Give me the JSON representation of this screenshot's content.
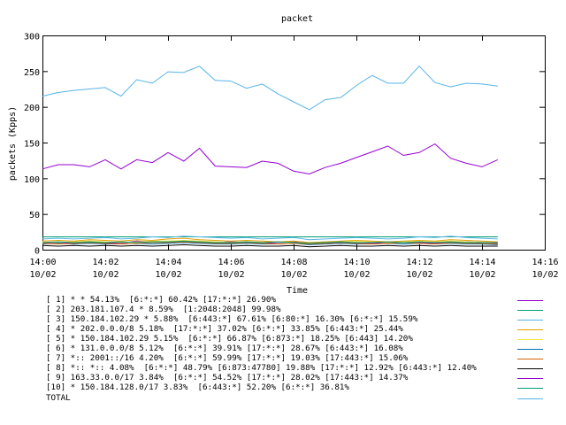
{
  "chart_data": {
    "type": "line",
    "title": "packet",
    "xlabel": "Time",
    "ylabel": "packets (Kpps)",
    "ylim": [
      0,
      300
    ],
    "yticks": [
      "0",
      "50",
      "100",
      "150",
      "200",
      "250",
      "300"
    ],
    "xticks": [
      {
        "time": "14:00",
        "date": "10/02"
      },
      {
        "time": "14:02",
        "date": "10/02"
      },
      {
        "time": "14:04",
        "date": "10/02"
      },
      {
        "time": "14:06",
        "date": "10/02"
      },
      {
        "time": "14:08",
        "date": "10/02"
      },
      {
        "time": "14:10",
        "date": "10/02"
      },
      {
        "time": "14:12",
        "date": "10/02"
      },
      {
        "time": "14:14",
        "date": "10/02"
      },
      {
        "time": "14:16",
        "date": "10/02"
      }
    ],
    "x": [
      "14:00",
      "14:00:30",
      "14:01",
      "14:01:30",
      "14:02",
      "14:02:30",
      "14:03",
      "14:03:30",
      "14:04",
      "14:04:30",
      "14:05",
      "14:05:30",
      "14:06",
      "14:06:30",
      "14:07",
      "14:07:30",
      "14:08",
      "14:08:30",
      "14:09",
      "14:09:30",
      "14:10",
      "14:10:30",
      "14:11",
      "14:11:30",
      "14:12",
      "14:12:30",
      "14:13",
      "14:13:30",
      "14:14",
      "14:14:30"
    ],
    "legend_position": "bottom",
    "grid": false,
    "series": [
      {
        "name": "[ 1] * * 54.13%  [6:*:*] 60.42% [17:*:*] 26.90%",
        "color": "#9400d3",
        "values": [
          10,
          10,
          9,
          11,
          10,
          9,
          12,
          11,
          10,
          12,
          11,
          10,
          11,
          10,
          9,
          10,
          11,
          9,
          8,
          9,
          10,
          9,
          10,
          11,
          10,
          9,
          10,
          11,
          10,
          9
        ]
      },
      {
        "name": "[ 2] 203.181.107.4 * 8.59%  [1:2048:2048] 99.98%",
        "color": "#009e73",
        "values": [
          18,
          18,
          18,
          18,
          18,
          18,
          18,
          18,
          18,
          18,
          18,
          18,
          18,
          18,
          18,
          18,
          18,
          18,
          18,
          18,
          18,
          18,
          18,
          18,
          18,
          18,
          18,
          18,
          18,
          18
        ]
      },
      {
        "name": "[ 3] 150.184.102.29 * 5.88%  [6:443:*] 67.61% [6:80:*] 16.30% [6:*:*] 15.59%",
        "color": "#56b4e9",
        "values": [
          15,
          16,
          15,
          16,
          17,
          15,
          16,
          18,
          17,
          19,
          18,
          17,
          16,
          17,
          15,
          16,
          17,
          14,
          15,
          16,
          17,
          16,
          15,
          16,
          18,
          17,
          19,
          17,
          16,
          15
        ]
      },
      {
        "name": "[ 4] * 202.0.0.0/8 5.18%  [17:*:*] 37.02% [6:*:*] 33.85% [6:443:*] 25.44%",
        "color": "#e69f00",
        "values": [
          12,
          13,
          12,
          14,
          13,
          12,
          14,
          13,
          15,
          16,
          14,
          13,
          12,
          13,
          12,
          11,
          12,
          10,
          11,
          12,
          13,
          12,
          11,
          12,
          13,
          12,
          14,
          13,
          12,
          11
        ]
      },
      {
        "name": "[ 5] * 150.184.102.29 5.15%  [6:*:*] 66.87% [6:873:*] 18.25% [6:443] 14.20%",
        "color": "#f0e442",
        "values": [
          11,
          10,
          11,
          12,
          11,
          10,
          11,
          12,
          12,
          13,
          12,
          11,
          10,
          11,
          10,
          11,
          10,
          9,
          10,
          11,
          12,
          11,
          10,
          11,
          12,
          11,
          12,
          11,
          10,
          10
        ]
      },
      {
        "name": "[ 6] * 131.0.0.0/8 5.12%  [6:*:*] 39.91% [17:*:*] 28.67% [6:443:*] 16.08%",
        "color": "#0072b2",
        "values": [
          8,
          9,
          8,
          9,
          8,
          8,
          9,
          8,
          9,
          10,
          9,
          8,
          8,
          9,
          8,
          8,
          9,
          7,
          8,
          9,
          8,
          8,
          9,
          8,
          9,
          8,
          9,
          8,
          8,
          7
        ]
      },
      {
        "name": "[ 7] *:: 2001::/16 4.20%  [6:*:*] 59.99% [17:*:*] 19.03% [17:443:*] 15.06%",
        "color": "#d55e00",
        "values": [
          9,
          8,
          9,
          10,
          9,
          8,
          9,
          10,
          10,
          11,
          10,
          9,
          9,
          10,
          9,
          8,
          9,
          8,
          9,
          10,
          9,
          8,
          9,
          10,
          9,
          8,
          10,
          9,
          9,
          8
        ]
      },
      {
        "name": "[ 8] *:: *:: 4.08%  [6:*:*] 48.79% [6:873:47780] 19.88% [17:*:*] 12.92% [6:443:*] 12.40%",
        "color": "#000000",
        "values": [
          6,
          5,
          6,
          5,
          6,
          5,
          6,
          5,
          6,
          7,
          6,
          5,
          5,
          6,
          5,
          5,
          6,
          4,
          5,
          6,
          5,
          5,
          6,
          5,
          6,
          5,
          6,
          5,
          5,
          5
        ]
      },
      {
        "name": "[ 9] 163.33.0.0/17 3.84%  [6:*:*] 54.52% [17:*:*] 28.02% [17:443:*] 14.37%",
        "color": "#9400d3",
        "values": [
          113,
          119,
          119,
          116,
          126,
          113,
          126,
          122,
          136,
          124,
          142,
          117,
          116,
          115,
          124,
          121,
          110,
          106,
          115,
          121,
          129,
          137,
          145,
          132,
          136,
          148,
          128,
          121,
          116,
          126
        ]
      },
      {
        "name": "[10] * 150.184.128.0/17 3.83%  [6:443:*] 52.20% [6:*:*] 36.81%",
        "color": "#009e73",
        "values": [
          10,
          11,
          10,
          11,
          10,
          11,
          10,
          11,
          11,
          12,
          11,
          10,
          10,
          11,
          10,
          11,
          10,
          9,
          10,
          11,
          10,
          10,
          11,
          10,
          11,
          10,
          11,
          10,
          10,
          10
        ]
      },
      {
        "name": "TOTAL",
        "color": "#56b4e9",
        "values": [
          215,
          220,
          223,
          225,
          227,
          215,
          238,
          233,
          249,
          248,
          257,
          237,
          236,
          226,
          232,
          218,
          207,
          196,
          210,
          213,
          230,
          244,
          233,
          233,
          257,
          234,
          228,
          233,
          232,
          229
        ]
      }
    ]
  }
}
